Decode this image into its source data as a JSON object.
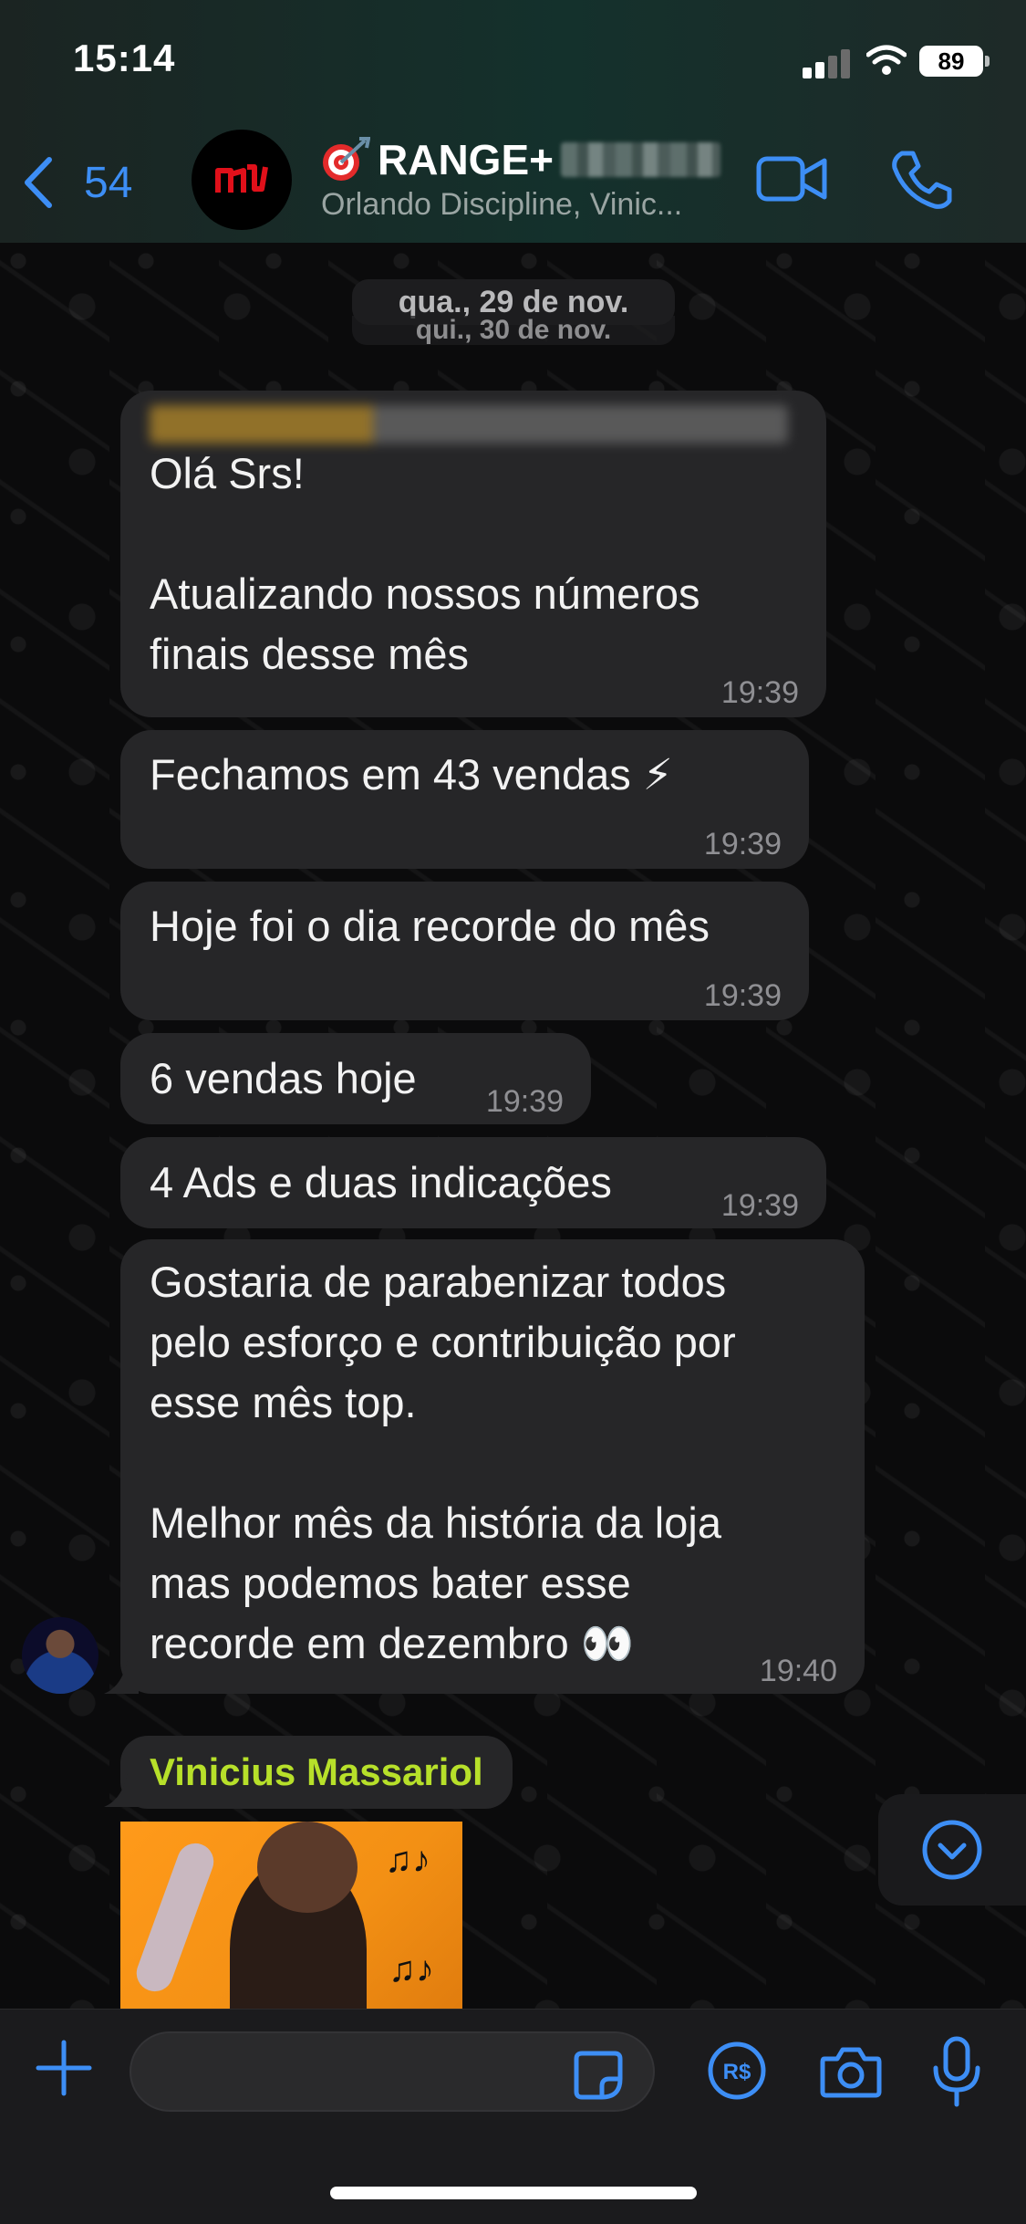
{
  "status_bar": {
    "time": "15:14",
    "battery": "89"
  },
  "header": {
    "back_count": "54",
    "title": "RANGE+",
    "subtitle": "Orlando Discipline, Vinic..."
  },
  "dates": {
    "top": "qua., 29 de nov.",
    "under": "qui., 30 de nov."
  },
  "messages": [
    {
      "text": "Olá Srs!\n\nAtualizando nossos números\nfinais desse mês",
      "time": "19:39"
    },
    {
      "text": "Fechamos em 43 vendas ⚡",
      "time": "19:39"
    },
    {
      "text": "Hoje foi o dia recorde do mês",
      "time": "19:39"
    },
    {
      "text": "6 vendas hoje",
      "time": "19:39"
    },
    {
      "text": "4 Ads e duas indicações",
      "time": "19:39"
    },
    {
      "text": "Gostaria de parabenizar todos\npelo esforço e contribuição por\nesse mês top.\n\nMelhor mês da história da loja\nmas podemos bater esse\nrecorde em dezembro 👀",
      "time": "19:40"
    }
  ],
  "next_sender": "Vinicius Massariol",
  "gif": {
    "notes": "♫♪"
  },
  "colors": {
    "accent": "#3d8ef5",
    "sender_name": "#b7e02a",
    "bubble": "#262628"
  },
  "icons": [
    "back-chevron-icon",
    "target-emoji-icon",
    "video-call-icon",
    "phone-icon",
    "scroll-down-icon",
    "plus-icon",
    "sticker-icon",
    "pix-payment-icon",
    "camera-icon",
    "microphone-icon"
  ]
}
